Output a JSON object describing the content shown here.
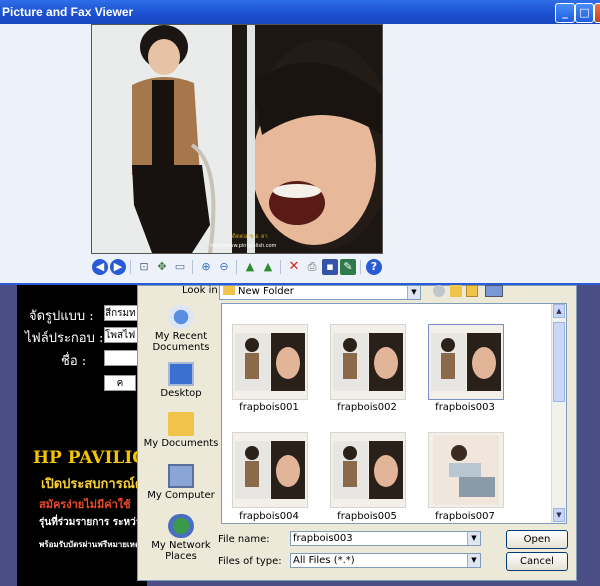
{
  "viewer": {
    "title": "Picture and Fax Viewer",
    "window_buttons": [
      "minimize",
      "maximize",
      "close"
    ],
    "photo_watermark": "ติดต่อ ช อ ลา",
    "photo_caption": "http://www.pinkpolish.com",
    "toolbar": [
      {
        "name": "previous-image-icon",
        "color": "#2a5bd7"
      },
      {
        "name": "next-image-icon",
        "color": "#2a5bd7"
      },
      {
        "name": "best-fit-icon",
        "color": "#5a6e8c"
      },
      {
        "name": "actual-size-icon",
        "color": "#3a7a3a"
      },
      {
        "name": "slideshow-icon",
        "color": "#5a6e8c"
      },
      {
        "name": "zoom-in-icon",
        "color": "#3a6fd0"
      },
      {
        "name": "zoom-out-icon",
        "color": "#3a6fd0"
      },
      {
        "name": "rotate-clockwise-icon",
        "color": "#2f8a2f"
      },
      {
        "name": "rotate-counterclockwise-icon",
        "color": "#2f8a2f"
      },
      {
        "name": "delete-icon",
        "color": "#d2261c"
      },
      {
        "name": "print-icon",
        "color": "#6a6a6a"
      },
      {
        "name": "save-icon",
        "color": "#3553a8"
      },
      {
        "name": "open-for-editing-icon",
        "color": "#2f7a4a"
      },
      {
        "name": "help-icon",
        "color": "#2a5bd7"
      }
    ]
  },
  "background_page": {
    "fields": [
      {
        "label": "จัดรูปแบบ :",
        "value": "สีกรมท"
      },
      {
        "label": "ไฟล์ประกอบ :",
        "value": "โพสไฟ"
      },
      {
        "label": "ชื่อ :",
        "value": ""
      }
    ],
    "button_partial": "ค",
    "promo": {
      "brand": "HP PAVILION",
      "line1": "เปิดประสบการณ์ค",
      "line2": "สมัครง่ายไม่มีค่าใช้",
      "line3": "รุ่นที่ร่วมรายการ ระหว่างวั",
      "line4": "พร้อมรับบัตรผ่านฟรีหมายเหตุ"
    }
  },
  "save_dialog": {
    "look_in_label": "Look in:",
    "look_in_value": "New Folder",
    "places": [
      {
        "label": "My Recent Documents",
        "icon": "recent-documents-icon"
      },
      {
        "label": "Desktop",
        "icon": "desktop-icon"
      },
      {
        "label": "My Documents",
        "icon": "my-documents-icon"
      },
      {
        "label": "My Computer",
        "icon": "my-computer-icon"
      },
      {
        "label": "My Network Places",
        "icon": "network-places-icon"
      }
    ],
    "files": [
      {
        "name": "frapbois001",
        "selected": false
      },
      {
        "name": "frapbois002",
        "selected": false
      },
      {
        "name": "frapbois003",
        "selected": true
      },
      {
        "name": "frapbois004",
        "selected": false
      },
      {
        "name": "frapbois005",
        "selected": false
      },
      {
        "name": "frapbois007",
        "selected": false
      }
    ],
    "file_name_label": "File name:",
    "file_name_value": "frapbois003",
    "file_type_label": "Files of type:",
    "file_type_value": "All Files (*.*)",
    "open_button": "Open",
    "cancel_button": "Cancel"
  }
}
